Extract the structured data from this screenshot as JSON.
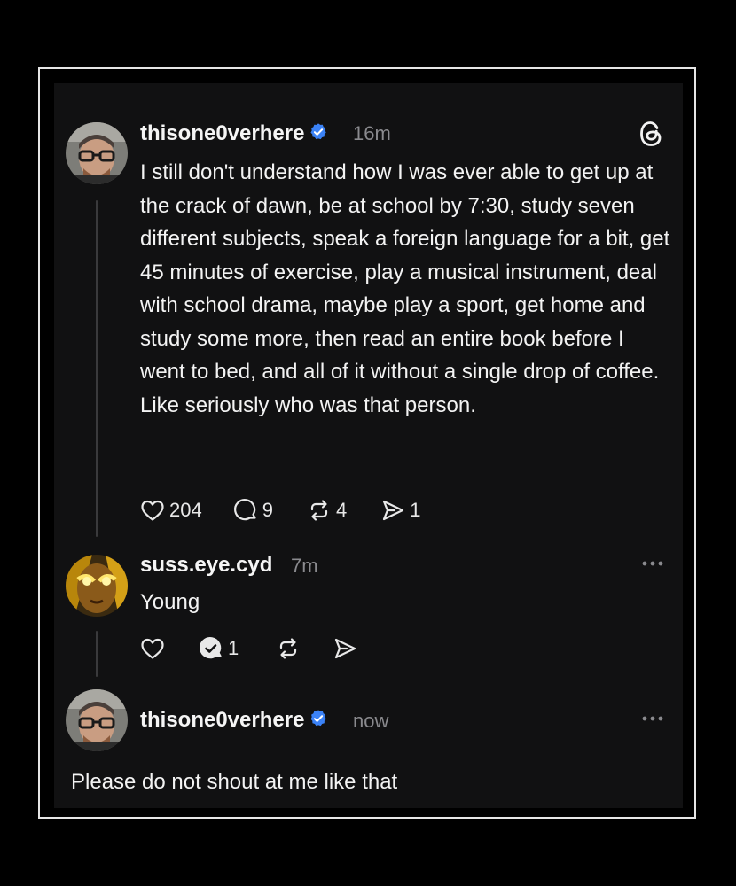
{
  "post": {
    "username": "thisone0verhere",
    "time": "16m",
    "text": "I still don't understand how I was ever able to get up at the crack of dawn, be at school by 7:30, study seven different subjects, speak a foreign language for a bit, get 45 minutes of exercise, play a musical instrument, deal with school drama, maybe play a sport, get home and study some more, then read an entire book before I went to bed, and all of it without a single drop of coffee. Like seriously who was that person.",
    "likes": "204",
    "comments": "9",
    "reposts": "4",
    "shares": "1"
  },
  "reply1": {
    "username": "suss.eye.cyd",
    "time": "7m",
    "text": "Young",
    "comments": "1"
  },
  "reply2": {
    "username": "thisone0verhere",
    "time": "now",
    "text": "Please do not shout at me like that"
  },
  "icons": {
    "app": "threads-logo-icon",
    "verified": "verified-badge-icon",
    "like": "heart-icon",
    "comment": "comment-bubble-icon",
    "repost": "repost-icon",
    "share": "send-icon",
    "more": "more-dots-icon"
  },
  "colors": {
    "background": "#111112",
    "verified": "#3b82f6",
    "muted": "#8a8a8e"
  }
}
